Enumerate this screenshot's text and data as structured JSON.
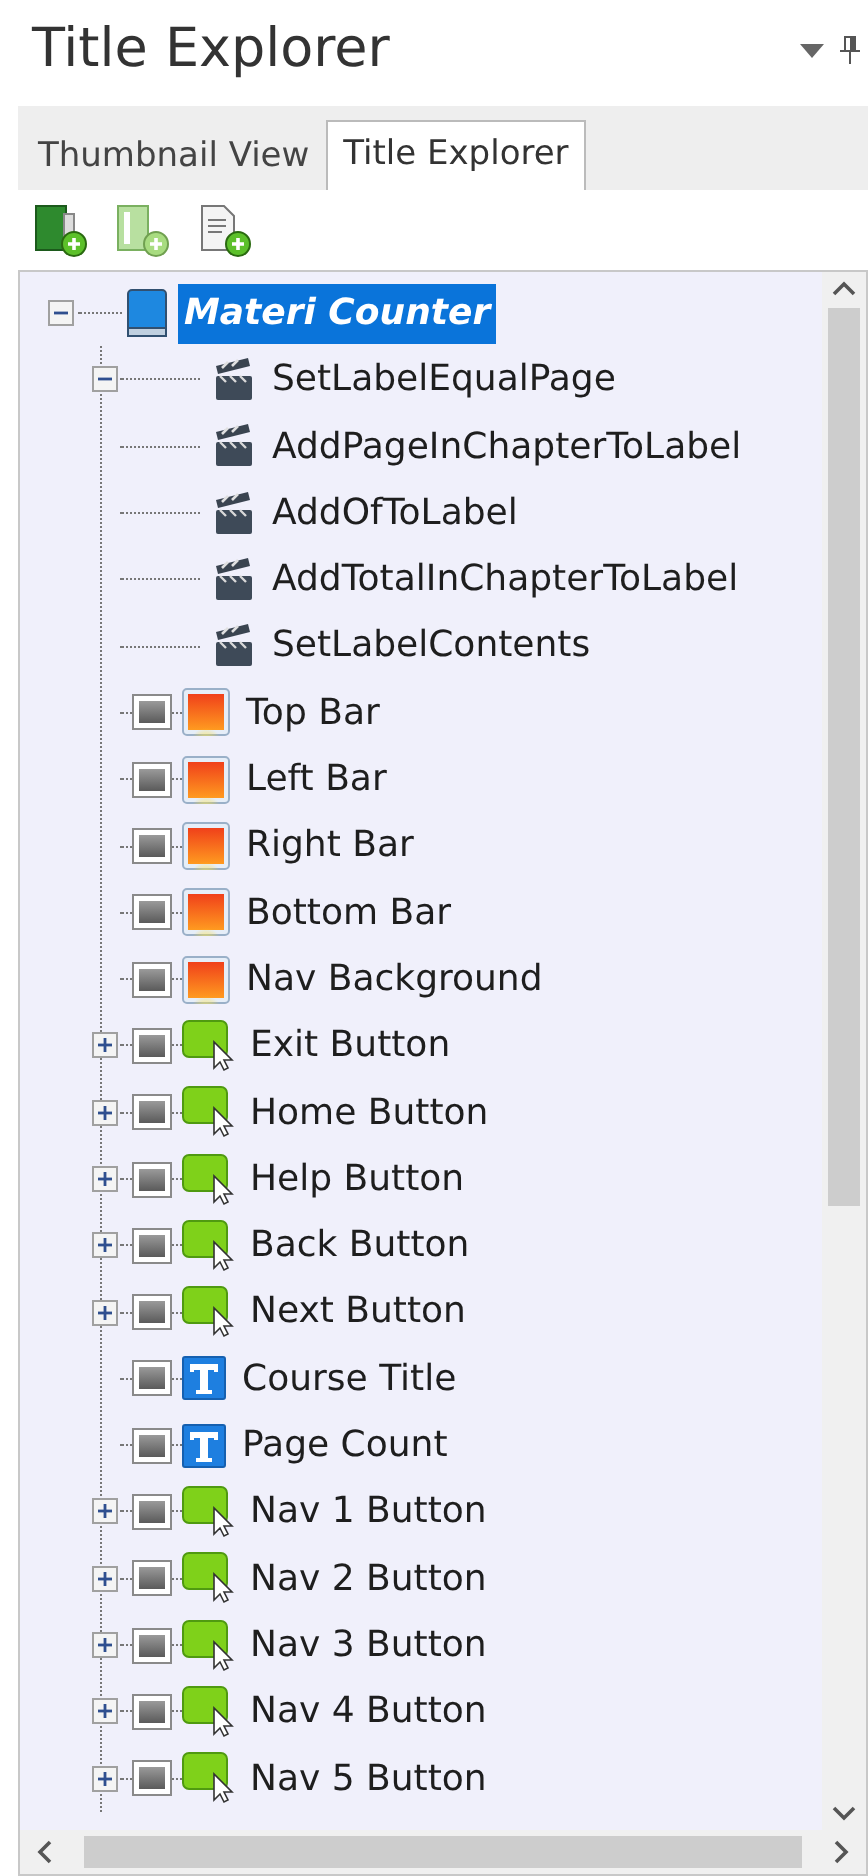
{
  "panel": {
    "title": "Title Explorer"
  },
  "tabs": [
    {
      "label": "Thumbnail View",
      "selected": false
    },
    {
      "label": "Title Explorer",
      "selected": true
    }
  ],
  "tree": {
    "label": "Materi Counter",
    "selected": true,
    "expanded": true,
    "children": [
      {
        "kind": "action",
        "label": "SetLabelEqualPage",
        "expanded": true
      },
      {
        "kind": "action",
        "label": "AddPageInChapterToLabel"
      },
      {
        "kind": "action",
        "label": "AddOfToLabel"
      },
      {
        "kind": "action",
        "label": "AddTotalInChapterToLabel"
      },
      {
        "kind": "action",
        "label": "SetLabelContents"
      },
      {
        "kind": "image",
        "label": "Top Bar"
      },
      {
        "kind": "image",
        "label": "Left Bar"
      },
      {
        "kind": "image",
        "label": "Right Bar"
      },
      {
        "kind": "image",
        "label": "Bottom Bar"
      },
      {
        "kind": "image",
        "label": "Nav Background"
      },
      {
        "kind": "button",
        "label": "Exit Button",
        "expanded": false
      },
      {
        "kind": "button",
        "label": "Home Button",
        "expanded": false
      },
      {
        "kind": "button",
        "label": "Help Button",
        "expanded": false
      },
      {
        "kind": "button",
        "label": "Back Button",
        "expanded": false
      },
      {
        "kind": "button",
        "label": "Next Button",
        "expanded": false
      },
      {
        "kind": "text",
        "label": "Course Title"
      },
      {
        "kind": "text",
        "label": "Page Count"
      },
      {
        "kind": "button",
        "label": "Nav 1 Button",
        "expanded": false
      },
      {
        "kind": "button",
        "label": "Nav 2 Button",
        "expanded": false
      },
      {
        "kind": "button",
        "label": "Nav 3 Button",
        "expanded": false
      },
      {
        "kind": "button",
        "label": "Nav 4 Button",
        "expanded": false
      },
      {
        "kind": "button",
        "label": "Nav 5 Button",
        "expanded": false
      }
    ]
  }
}
